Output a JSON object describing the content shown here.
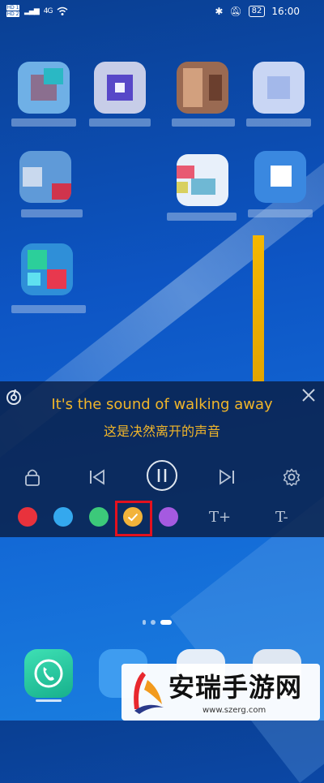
{
  "status_bar": {
    "sim1": "HD 1",
    "sim2": "HD 2",
    "signal_label": "4G",
    "battery": "82",
    "time": "16:00"
  },
  "lyrics": {
    "line_en": "It's the sound of walking away",
    "line_zh": "这是决然离开的声音"
  },
  "controls": {
    "lock_icon": "lock-icon",
    "prev_icon": "skip-previous-icon",
    "pause_icon": "pause-icon",
    "next_icon": "skip-next-icon",
    "settings_icon": "gear-icon",
    "font_increase_label": "T+",
    "font_decrease_label": "T-"
  },
  "color_options": [
    {
      "name": "red",
      "hex": "#e8323c",
      "selected": false
    },
    {
      "name": "light-blue",
      "hex": "#34a8ee",
      "selected": false
    },
    {
      "name": "green",
      "hex": "#3cc97a",
      "selected": false
    },
    {
      "name": "orange",
      "hex": "#f2b33a",
      "selected": true
    },
    {
      "name": "purple",
      "hex": "#a55ae0",
      "selected": false
    }
  ],
  "accent_color": "#f0b52a",
  "watermark": {
    "title": "安瑞手游网",
    "url": "www.szerg.com"
  }
}
